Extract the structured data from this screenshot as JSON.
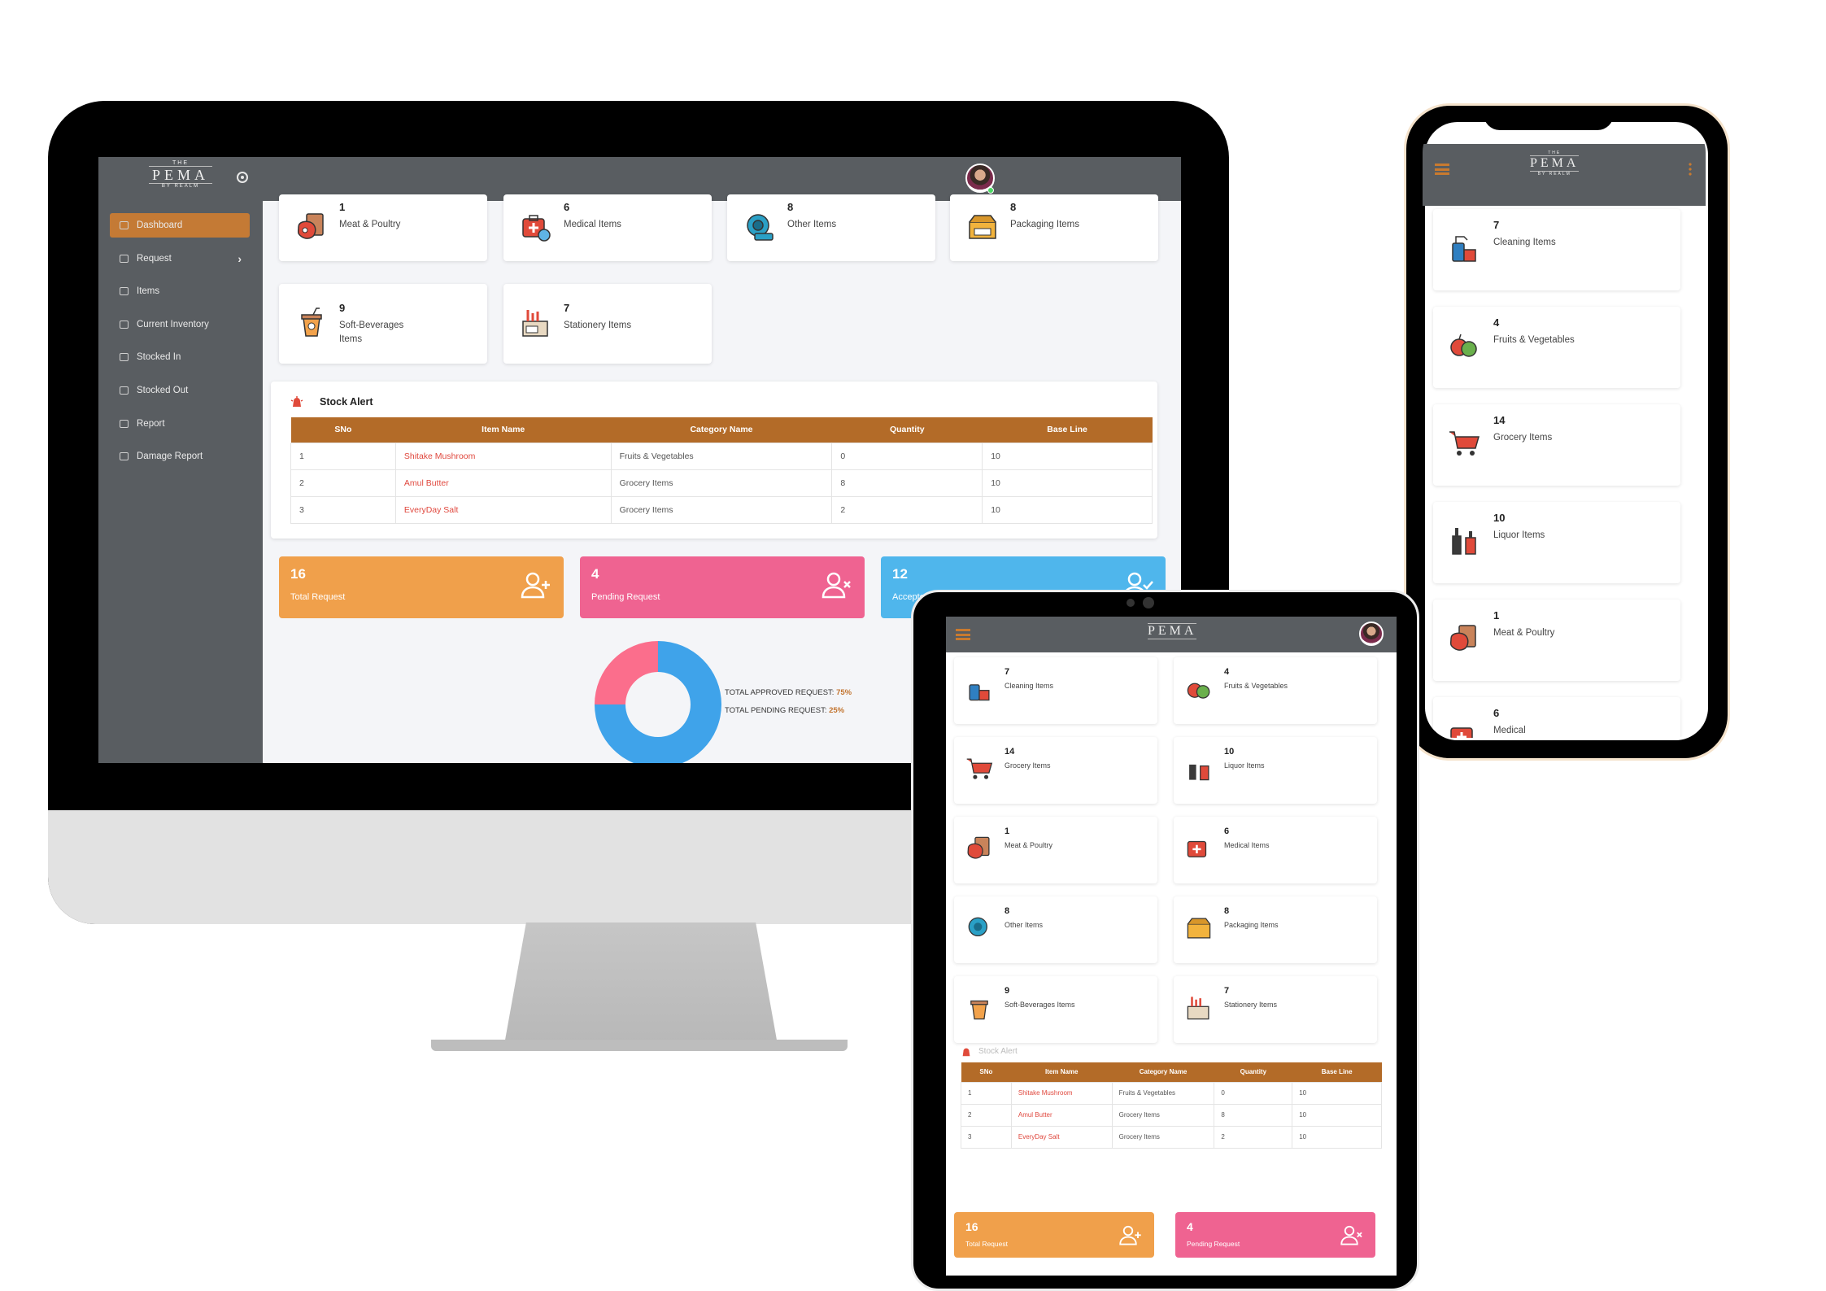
{
  "brand": {
    "the": "THE",
    "name": "PEMA",
    "by": "BY REALM"
  },
  "sidebar": {
    "items": [
      {
        "label": "Dashboard",
        "icon": "cloud-icon"
      },
      {
        "label": "Request",
        "icon": "exchange-icon"
      },
      {
        "label": "Items",
        "icon": "box-icon"
      },
      {
        "label": "Current Inventory",
        "icon": "box-icon"
      },
      {
        "label": "Stocked In",
        "icon": "stock-in-icon"
      },
      {
        "label": "Stocked Out",
        "icon": "stock-out-icon"
      },
      {
        "label": "Report",
        "icon": "report-icon"
      },
      {
        "label": "Damage Report",
        "icon": "report-icon"
      }
    ],
    "request_chevron": "›"
  },
  "desktop": {
    "tiles_row1": [
      {
        "count": "1",
        "label": "Meat & Poultry",
        "icon": "meat-icon"
      },
      {
        "count": "6",
        "label": "Medical Items",
        "icon": "medical-icon"
      },
      {
        "count": "8",
        "label": "Other Items",
        "icon": "other-icon"
      },
      {
        "count": "8",
        "label": "Packaging Items",
        "icon": "packaging-icon"
      }
    ],
    "tiles_row2": [
      {
        "count": "9",
        "label": "Soft-Beverages Items",
        "icon": "beverage-icon"
      },
      {
        "count": "7",
        "label": "Stationery Items",
        "icon": "stationery-icon"
      }
    ]
  },
  "stock_alert": {
    "title": "Stock Alert",
    "columns": [
      "SNo",
      "Item Name",
      "Category Name",
      "Quantity",
      "Base Line"
    ],
    "rows": [
      [
        "1",
        "Shitake Mushroom",
        "Fruits & Vegetables",
        "0",
        "10"
      ],
      [
        "2",
        "Amul Butter",
        "Grocery Items",
        "8",
        "10"
      ],
      [
        "3",
        "EveryDay Salt",
        "Grocery Items",
        "2",
        "10"
      ]
    ]
  },
  "stats": {
    "total": {
      "count": "16",
      "label": "Total Request",
      "color": "#f0a04b"
    },
    "pending": {
      "count": "4",
      "label": "Pending Request",
      "color": "#ef6391"
    },
    "accepted": {
      "count": "12",
      "label": "Accepted Request",
      "color": "#4fb6ec"
    }
  },
  "donut": {
    "approved_label": "TOTAL APPROVED REQUEST:",
    "approved_value": "75%",
    "pending_label": "TOTAL PENDING REQUEST:",
    "pending_value": "25%",
    "approved_fraction": 0.75,
    "pending_fraction": 0.25,
    "approved_color": "#3fa3ea",
    "pending_color": "#fb6e8c"
  },
  "phone": {
    "tiles": [
      {
        "count": "7",
        "label": "Cleaning Items",
        "icon": "cleaning-icon"
      },
      {
        "count": "4",
        "label": "Fruits & Vegetables",
        "icon": "fruits-icon"
      },
      {
        "count": "14",
        "label": "Grocery Items",
        "icon": "grocery-icon"
      },
      {
        "count": "10",
        "label": "Liquor Items",
        "icon": "liquor-icon"
      },
      {
        "count": "1",
        "label": "Meat & Poultry",
        "icon": "meat-icon"
      },
      {
        "count": "6",
        "label": "Medical",
        "icon": "medical-icon"
      }
    ]
  },
  "tablet": {
    "tiles": [
      {
        "count": "7",
        "label": "Cleaning Items",
        "icon": "cleaning-icon"
      },
      {
        "count": "4",
        "label": "Fruits & Vegetables",
        "icon": "fruits-icon"
      },
      {
        "count": "14",
        "label": "Grocery Items",
        "icon": "grocery-icon"
      },
      {
        "count": "10",
        "label": "Liquor Items",
        "icon": "liquor-icon"
      },
      {
        "count": "1",
        "label": "Meat & Poultry",
        "icon": "meat-icon"
      },
      {
        "count": "6",
        "label": "Medical Items",
        "icon": "medical-icon"
      },
      {
        "count": "8",
        "label": "Other Items",
        "icon": "other-icon"
      },
      {
        "count": "8",
        "label": "Packaging Items",
        "icon": "packaging-icon"
      },
      {
        "count": "9",
        "label": "Soft-Beverages Items",
        "icon": "beverage-icon"
      },
      {
        "count": "7",
        "label": "Stationery Items",
        "icon": "stationery-icon"
      }
    ],
    "alert_title": "Stock Alert"
  },
  "accent_color": "#c47a35"
}
